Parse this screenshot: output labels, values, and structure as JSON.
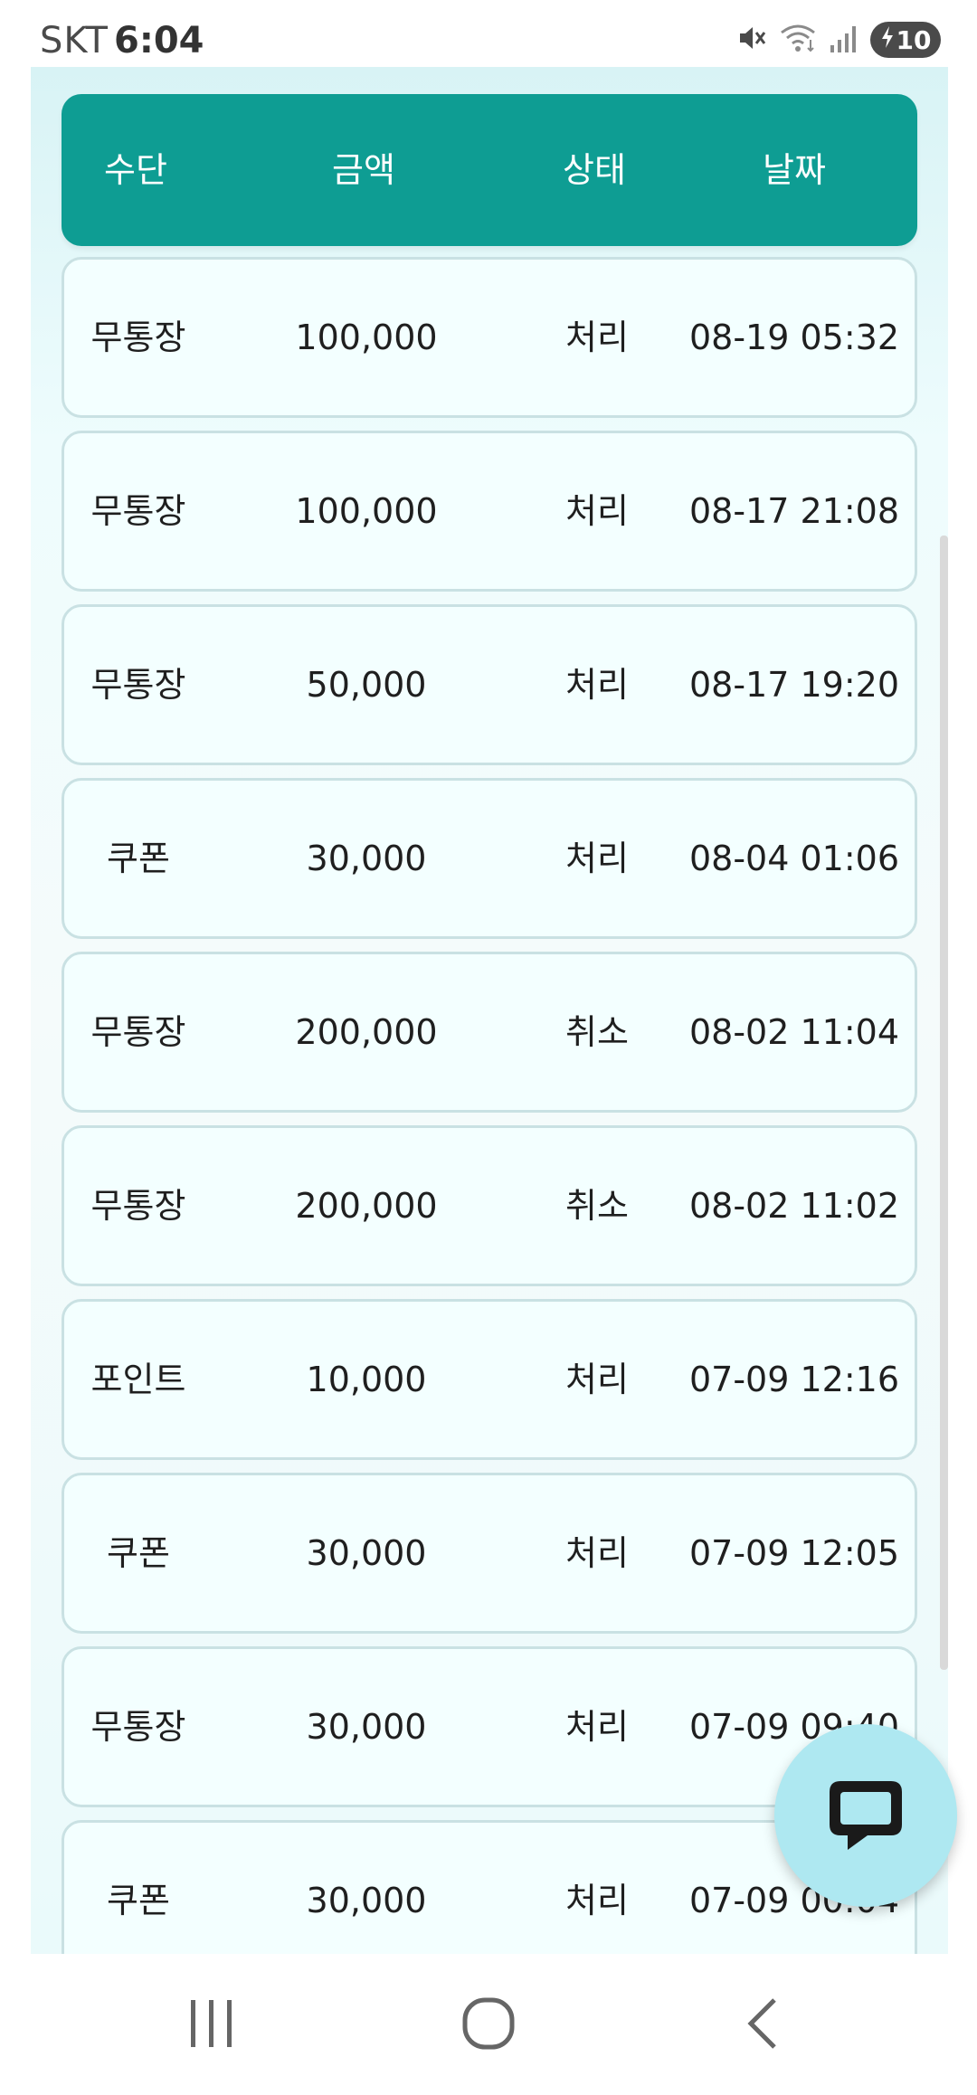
{
  "status_bar": {
    "carrier": "SKT",
    "time": "6:04",
    "battery": "10",
    "icons": [
      "mute-icon",
      "wifi-icon",
      "signal-icon",
      "battery-charging-icon"
    ]
  },
  "table": {
    "header": {
      "method": "수단",
      "amount": "금액",
      "status": "상태",
      "date": "날짜"
    },
    "rows": [
      {
        "method": "무통장",
        "amount": "100,000",
        "status": "처리",
        "date": "08-19 05:32"
      },
      {
        "method": "무통장",
        "amount": "100,000",
        "status": "처리",
        "date": "08-17 21:08"
      },
      {
        "method": "무통장",
        "amount": "50,000",
        "status": "처리",
        "date": "08-17 19:20"
      },
      {
        "method": "쿠폰",
        "amount": "30,000",
        "status": "처리",
        "date": "08-04 01:06"
      },
      {
        "method": "무통장",
        "amount": "200,000",
        "status": "취소",
        "date": "08-02 11:04"
      },
      {
        "method": "무통장",
        "amount": "200,000",
        "status": "취소",
        "date": "08-02 11:02"
      },
      {
        "method": "포인트",
        "amount": "10,000",
        "status": "처리",
        "date": "07-09 12:16"
      },
      {
        "method": "쿠폰",
        "amount": "30,000",
        "status": "처리",
        "date": "07-09 12:05"
      },
      {
        "method": "무통장",
        "amount": "30,000",
        "status": "처리",
        "date": "07-09 09:40"
      },
      {
        "method": "쿠폰",
        "amount": "30,000",
        "status": "처리",
        "date": "07-09 00:04"
      }
    ]
  },
  "chat_button": {
    "icon": "chat-bubble-icon"
  },
  "nav_bar": {
    "icons": [
      "recent-apps-icon",
      "home-icon",
      "back-icon"
    ]
  },
  "colors": {
    "header_bg": "#0e9d93",
    "row_bg": "#f3ffff",
    "row_border": "#c9e1e3",
    "chat_bg": "#aee8f1"
  }
}
